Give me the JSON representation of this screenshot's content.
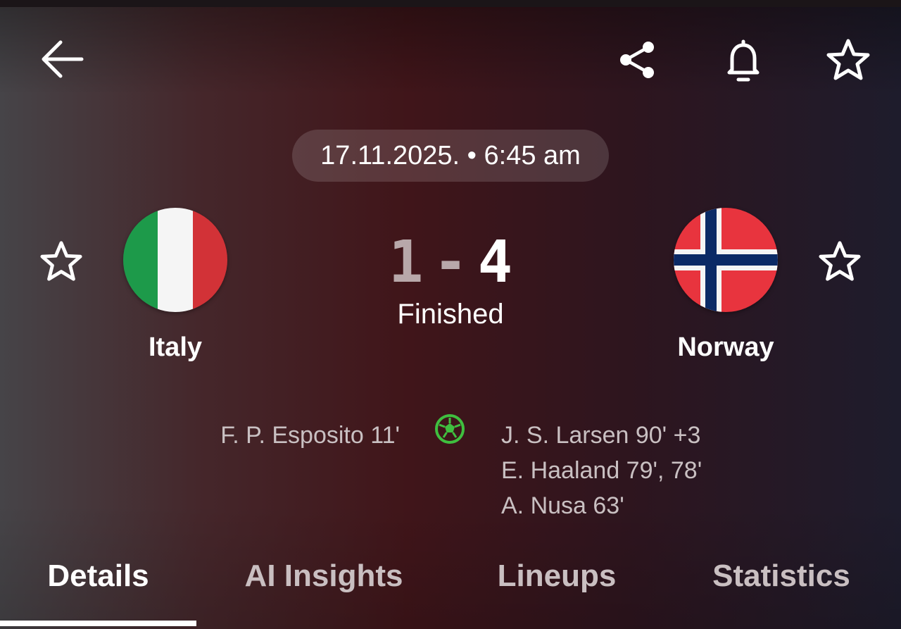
{
  "header": {
    "back_icon": "arrow-left-icon",
    "share_icon": "share-icon",
    "bell_icon": "bell-icon",
    "favorite_icon": "star-outline-icon"
  },
  "match": {
    "datetime": "17.11.2025. • 6:45 am",
    "home_score": "1",
    "separator": "-",
    "away_score": "4",
    "status": "Finished"
  },
  "home": {
    "name": "Italy",
    "flag": "italy-flag",
    "scorers": [
      "F. P. Esposito 11'"
    ]
  },
  "away": {
    "name": "Norway",
    "flag": "norway-flag",
    "scorers": [
      "J. S. Larsen 90' +3",
      "E. Haaland 79', 78'",
      "A. Nusa 63'"
    ]
  },
  "goal_icon": "soccer-ball-icon",
  "goal_icon_color": "#3fbf3f",
  "tabs": [
    {
      "label": "Details",
      "active": true
    },
    {
      "label": "AI Insights",
      "active": false
    },
    {
      "label": "Lineups",
      "active": false
    },
    {
      "label": "Statistics",
      "active": false
    }
  ]
}
